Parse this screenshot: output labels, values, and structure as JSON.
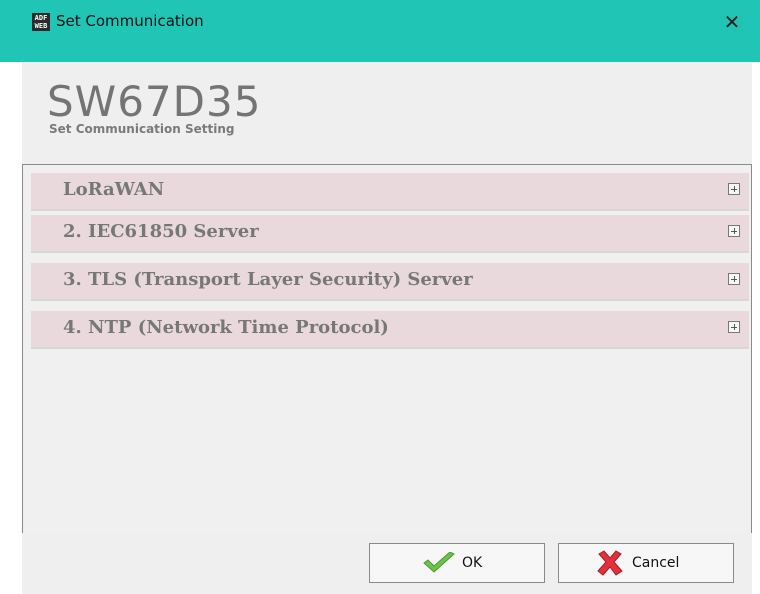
{
  "window": {
    "title": "Set Communication",
    "icon_text_top": "ADF",
    "icon_text_bottom": "WEB",
    "close_glyph": "✕"
  },
  "header": {
    "product_code": "SW67D35",
    "subtitle": "Set Communication Setting"
  },
  "sections": [
    {
      "label": "LoRaWAN"
    },
    {
      "label": "2. IEC61850 Server"
    },
    {
      "label": "3. TLS (Transport Layer Security) Server"
    },
    {
      "label": "4. NTP (Network Time Protocol)"
    }
  ],
  "buttons": {
    "ok_label": "OK",
    "cancel_label": "Cancel"
  },
  "colors": {
    "titlebar": "#20c5b5",
    "section_bg": "#ead9dc",
    "ok_check": "#6cc24a",
    "cancel_x": "#e0313c"
  },
  "icons": {
    "section_expand": "plus-box-icon",
    "ok": "checkmark-icon",
    "cancel": "red-x-icon",
    "close": "close-icon"
  }
}
